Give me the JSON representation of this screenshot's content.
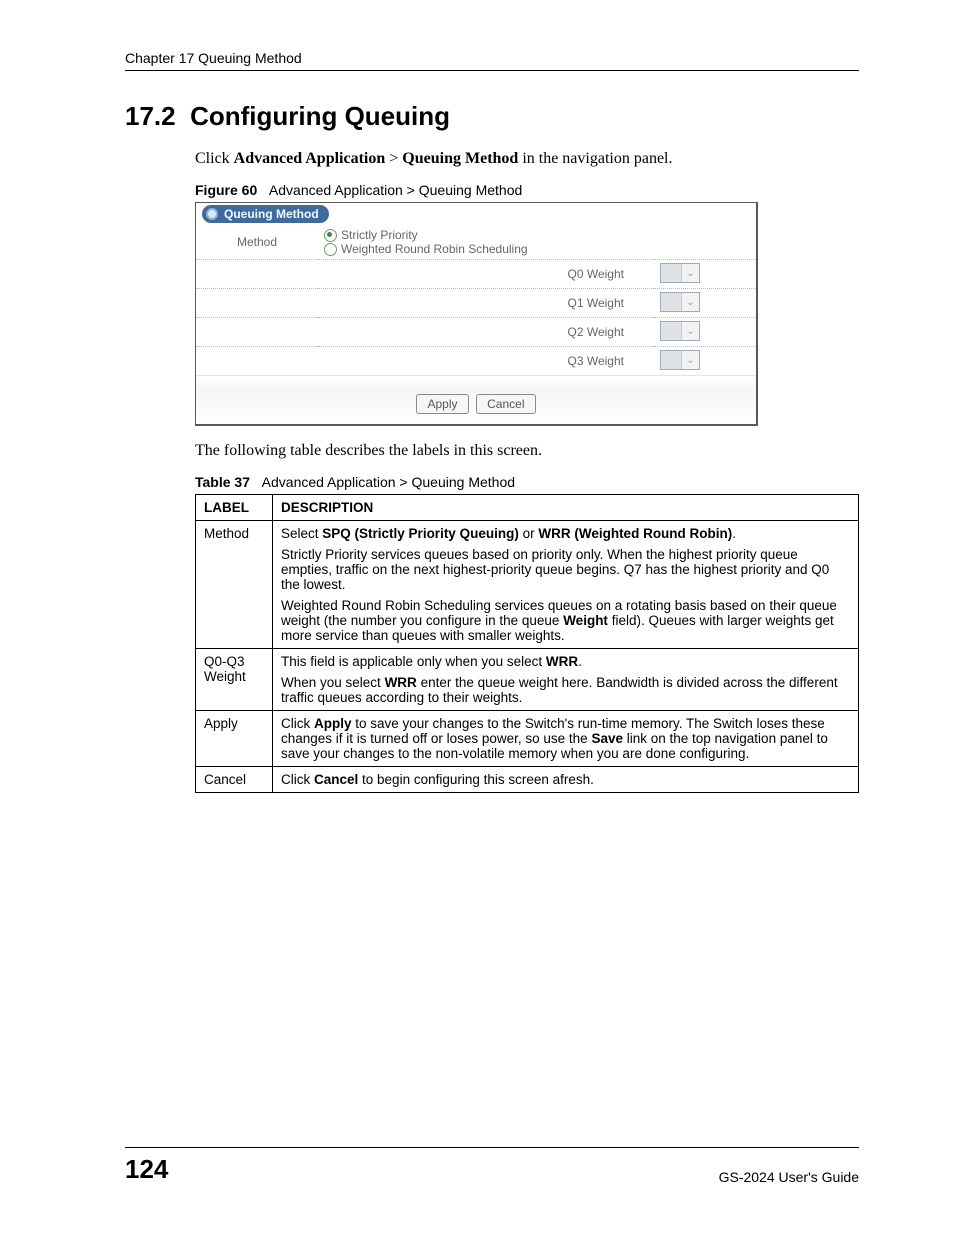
{
  "running_head": "Chapter 17 Queuing Method",
  "section": {
    "number": "17.2",
    "title": "Configuring Queuing"
  },
  "intro": {
    "pre": "Click ",
    "bold1": "Advanced Application",
    "sep": " > ",
    "bold2": "Queuing Method",
    "post": " in the navigation panel."
  },
  "figure": {
    "label": "Figure 60",
    "caption": "Advanced Application > Queuing Method",
    "panel_title": "Queuing Method",
    "row_method_label": "Method",
    "method_opt1": "Strictly Priority",
    "method_opt2": "Weighted Round Robin Scheduling",
    "weights": [
      "Q0 Weight",
      "Q1 Weight",
      "Q2 Weight",
      "Q3 Weight"
    ],
    "apply": "Apply",
    "cancel": "Cancel"
  },
  "after_figure": "The following table describes the labels in this screen.",
  "table": {
    "label": "Table 37",
    "caption": "Advanced Application > Queuing Method",
    "head_label": "LABEL",
    "head_desc": "DESCRIPTION",
    "rows": [
      {
        "label": "Method",
        "p1a": "Select ",
        "p1b": "SPQ (Strictly Priority Queuing)",
        "p1c": " or ",
        "p1d": "WRR (Weighted Round Robin)",
        "p1e": ".",
        "p2": "Strictly Priority services queues based on priority only. When the highest priority queue empties, traffic on the next highest-priority queue begins. Q7 has the highest priority and Q0 the lowest.",
        "p3a": "Weighted Round Robin Scheduling services queues on a rotating basis based on their queue weight (the number you configure in the queue ",
        "p3b": "Weight",
        "p3c": " field). Queues with larger weights get more service than queues with smaller weights."
      },
      {
        "label": "Q0-Q3 Weight",
        "p1a": "This field is applicable only when you select ",
        "p1b": "WRR",
        "p1c": ".",
        "p2a": "When you select ",
        "p2b": "WRR",
        "p2c": " enter the queue weight here. Bandwidth is divided across the different traffic queues according to their weights."
      },
      {
        "label": "Apply",
        "p1a": "Click ",
        "p1b": "Apply",
        "p1c": " to save your changes to the Switch's run-time memory. The Switch loses these changes if it is turned off or loses power, so use the ",
        "p1d": "Save",
        "p1e": " link on the top navigation panel to save your changes to the non-volatile memory when you are done configuring."
      },
      {
        "label": "Cancel",
        "p1a": "Click ",
        "p1b": "Cancel",
        "p1c": " to begin configuring this screen afresh."
      }
    ]
  },
  "footer": {
    "page": "124",
    "guide": "GS-2024 User's Guide"
  }
}
